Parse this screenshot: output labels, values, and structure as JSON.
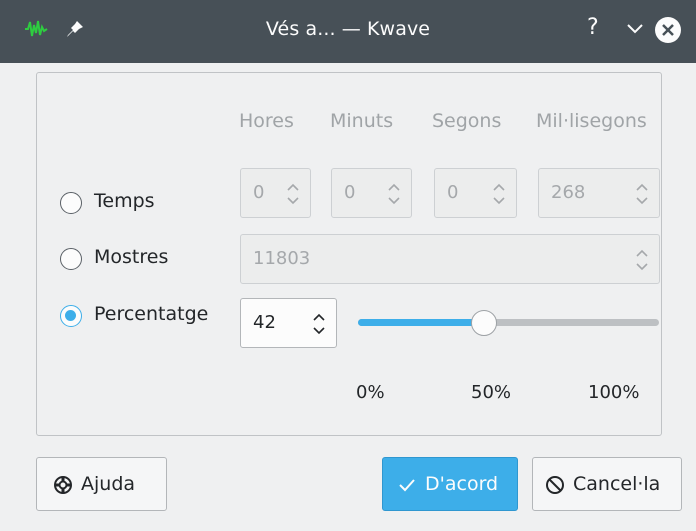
{
  "window": {
    "title": "Vés a... — Kwave",
    "help_label": "?"
  },
  "columns": {
    "hours": "Hores",
    "minutes": "Minuts",
    "seconds": "Segons",
    "milliseconds": "Mil·lisegons"
  },
  "options": {
    "time_label": "Temps",
    "samples_label": "Mostres",
    "percentage_label": "Percentatge",
    "selected": "percentage"
  },
  "time": {
    "hours": "0",
    "minutes": "0",
    "seconds": "0",
    "milliseconds": "268"
  },
  "samples": {
    "value": "11803"
  },
  "percentage": {
    "value": "42",
    "slider_fraction": 0.42,
    "ticks": [
      "0%",
      "50%",
      "100%"
    ]
  },
  "buttons": {
    "help": "Ajuda",
    "ok": "D'acord",
    "cancel": "Cancel·la"
  },
  "colors": {
    "accent": "#3daee9",
    "titlebar": "#475057"
  }
}
